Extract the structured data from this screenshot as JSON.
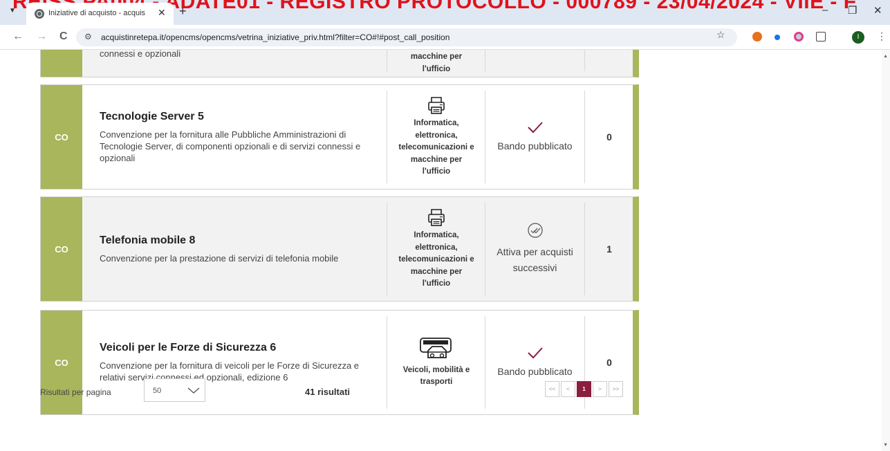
{
  "browser": {
    "watermark": "REISS PA004 - ADATE01 - REGISTRO PROTOCOLLO - 000789 - 23/04/2024 - VIIE - F",
    "tab_title": "Iniziative di acquisto - acquisti",
    "tab_close": "✕",
    "new_tab": "+",
    "url": "acquistinretepa.it/opencms/opencms/vetrina_iniziative_priv.html?filter=CO#!#post_call_position",
    "profile_initial": "I",
    "window": {
      "minimize": "–",
      "restore": "❐",
      "close": "✕"
    },
    "nav": {
      "back": "←",
      "forward": "→",
      "reload": "C"
    }
  },
  "top_partial": {
    "desc_fragment": "connessi e opzionali",
    "cat_fragment_1": "macchine per",
    "cat_fragment_2": "l'ufficio"
  },
  "rows": [
    {
      "code": "CO",
      "title": "Tecnologie Server 5",
      "description": "Convenzione per la fornitura alle Pubbliche Amministrazioni di Tecnologie Server, di componenti opzionali e di servizi connessi e opzionali",
      "category": "Informatica, elettronica, telecomunicazioni e macchine per l'ufficio",
      "category_icon": "printer-icon",
      "status": "Bando pubblicato",
      "status_icon": "check-icon",
      "count": "0"
    },
    {
      "code": "CO",
      "title": "Telefonia mobile 8",
      "description": "Convenzione per la prestazione di servizi di telefonia mobile",
      "category": "Informatica, elettronica, telecomunicazioni e macchine per l'ufficio",
      "category_icon": "printer-icon",
      "status": "Attiva per acquisti successivi",
      "status_icon": "double-check-circle-icon",
      "count": "1"
    },
    {
      "code": "CO",
      "title": "Veicoli per le Forze di Sicurezza 6",
      "description": "Convenzione per la fornitura di veicoli per le Forze di Sicurezza e relativi servizi connessi ed opzionali, edizione 6",
      "category": "Veicoli, mobilità e trasporti",
      "category_icon": "vehicles-icon",
      "status": "Bando pubblicato",
      "status_icon": "check-icon",
      "count": "0"
    }
  ],
  "footer": {
    "rpp_label": "Risultati per pagina",
    "rpp_value": "50",
    "results": "41 risultati",
    "pager": [
      "<<",
      "<",
      "1",
      ">",
      ">>"
    ],
    "current_page": "1"
  },
  "colors": {
    "accent_green": "#a9b65b",
    "status_maroon": "#8b1d3f",
    "watermark_red": "#e0121b"
  }
}
